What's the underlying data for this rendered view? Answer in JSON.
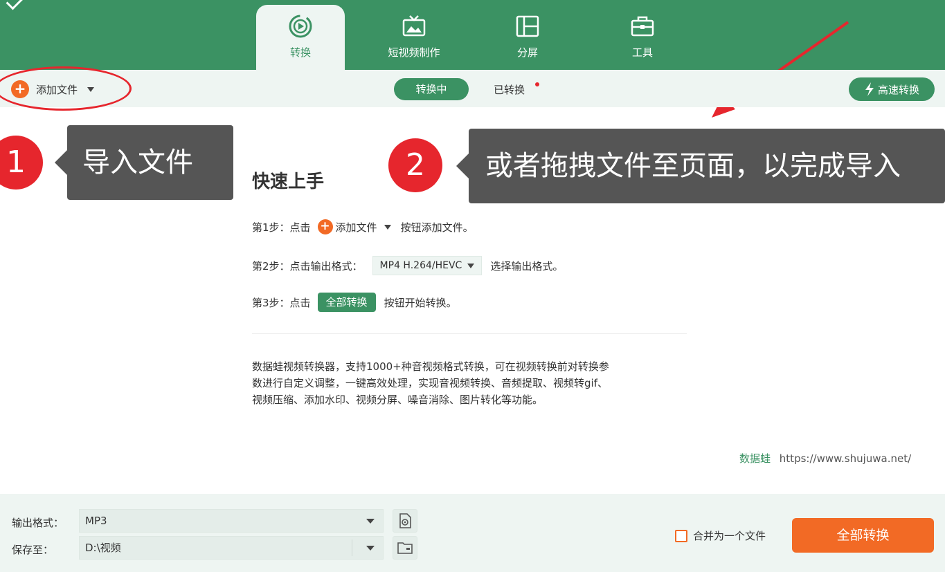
{
  "nav": {
    "tabs": [
      {
        "label": "转换",
        "icon": "convert-play-icon",
        "active": true
      },
      {
        "label": "短视频制作",
        "icon": "tv-icon",
        "active": false
      },
      {
        "label": "分屏",
        "icon": "split-screen-icon",
        "active": false
      },
      {
        "label": "工具",
        "icon": "toolbox-icon",
        "active": false
      }
    ]
  },
  "toolbar": {
    "add_file_label": "添加文件",
    "converting_label": "转换中",
    "converted_label": "已转换",
    "fast_convert_label": "高速转换"
  },
  "callouts": {
    "one": {
      "number": "1",
      "text": "导入文件"
    },
    "two": {
      "number": "2",
      "text": "或者拖拽文件至页面，以完成导入"
    }
  },
  "guide": {
    "title": "快速上手",
    "step1": {
      "prefix": "第1步：点击",
      "button_label": "添加文件",
      "suffix": "按钮添加文件。"
    },
    "step2": {
      "prefix": "第2步：点击输出格式：",
      "format_label": "MP4 H.264/HEVC",
      "suffix": "选择输出格式。"
    },
    "step3": {
      "prefix": "第3步：点击",
      "button_label": "全部转换",
      "suffix": "按钮开始转换。"
    },
    "description": [
      "数据蛙视频转换器，支持1000+种音视频格式转换，可在视频转换前对转换参",
      "数进行自定义调整，一键高效处理，实现音视频转换、音频提取、视频转gif、",
      "视频压缩、添加水印、视频分屏、噪音消除、图片转化等功能。"
    ]
  },
  "watermark": {
    "brand": "数据蛙",
    "url": "https://www.shujuwa.net/"
  },
  "bottom": {
    "output_format_label": "输出格式：",
    "output_format_value": "MP3",
    "save_to_label": "保存至：",
    "save_to_value": "D:\\视频",
    "merge_label": "合并为一个文件",
    "convert_all_label": "全部转换"
  },
  "colors": {
    "brand_green": "#3b9263",
    "accent_orange": "#f26a25",
    "annotation_red": "#e6262d",
    "callout_gray": "#555555"
  }
}
